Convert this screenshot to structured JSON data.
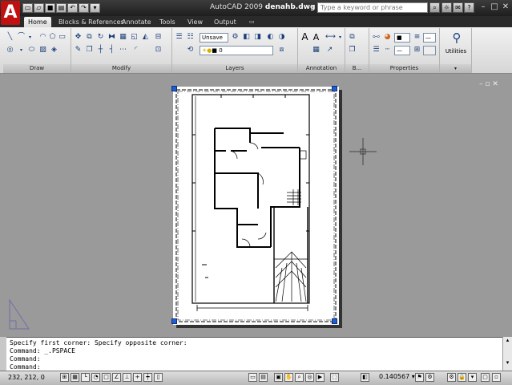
{
  "app": {
    "logo": "A",
    "title_app": "AutoCAD 2009",
    "title_file": "denahb.dwg",
    "search_placeholder": "Type a keyword or phrase"
  },
  "tabs": [
    "Home",
    "Blocks & References",
    "Annotate",
    "Tools",
    "View",
    "Output"
  ],
  "ribbon": {
    "panels": [
      "Draw",
      "Modify",
      "Layers",
      "Annotation",
      "B...",
      "Properties"
    ],
    "layer_state": "Unsave",
    "layer_current": "0",
    "utilities_label": "Utilities"
  },
  "command": {
    "lines": [
      "Specify first corner: Specify opposite corner:",
      "Command: _.PSPACE",
      "Command:",
      "Command:"
    ]
  },
  "status": {
    "coords": "232, 212, 0",
    "scale": "0.140567"
  },
  "colors": {
    "title_bg": "#1e1e1e",
    "ribbon_bg": "#e4e4e4",
    "drawing_bg": "#9a9a9a",
    "grip": "#1f5fd6",
    "logo": "#c01010"
  }
}
